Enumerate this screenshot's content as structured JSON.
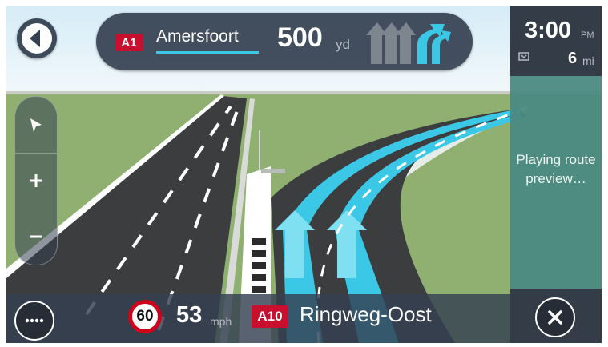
{
  "instruction": {
    "road_number": "A1",
    "street_name": "Amersfoort",
    "distance": "500",
    "distance_unit": "yd"
  },
  "eta": {
    "time": "3:00",
    "ampm": "PM",
    "remaining_distance": "6",
    "remaining_unit": "mi"
  },
  "route_preview": {
    "status": "Playing route preview…"
  },
  "bottom_bar": {
    "speed_limit": "60",
    "current_speed": "53",
    "speed_unit": "mph",
    "road_number": "A10",
    "street_name": "Ringweg-Oost"
  },
  "colors": {
    "panel_dark": "#344050",
    "road_shield": "#c8102e",
    "route_highlight": "#3bc8e6",
    "side_panel": "#4b8a82",
    "grass": "#8fb071"
  },
  "icons": {
    "back": "back-arrow-icon",
    "pan": "pan-cursor-icon",
    "zoom_in": "plus-icon",
    "zoom_out": "minus-icon",
    "menu": "more-dots-icon",
    "close": "close-icon",
    "destination": "destination-flag-icon",
    "lane_guidance": "lane-arrows-icon"
  }
}
